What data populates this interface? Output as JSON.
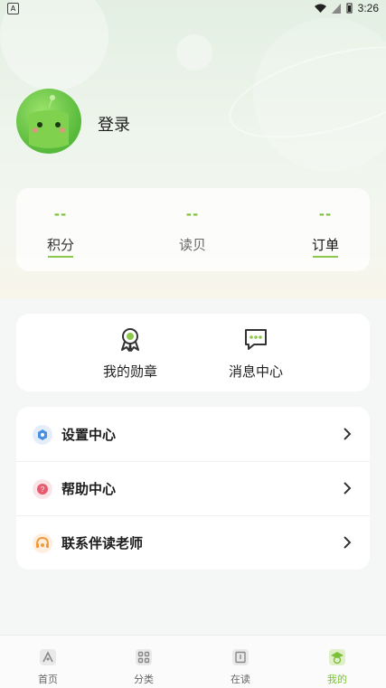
{
  "status_bar": {
    "time": "3:26",
    "app_badge": "A"
  },
  "profile": {
    "login_label": "登录"
  },
  "stats": [
    {
      "value": "--",
      "label": "积分"
    },
    {
      "value": "--",
      "label": "读贝"
    },
    {
      "value": "--",
      "label": "订单"
    }
  ],
  "shortcuts": [
    {
      "label": "我的勋章",
      "icon": "medal-icon"
    },
    {
      "label": "消息中心",
      "icon": "message-icon"
    }
  ],
  "menu": [
    {
      "label": "设置中心",
      "icon": "settings-icon",
      "color": "#4a90e2"
    },
    {
      "label": "帮助中心",
      "icon": "help-icon",
      "color": "#e85a6e"
    },
    {
      "label": "联系伴读老师",
      "icon": "contact-icon",
      "color": "#f29a3b"
    }
  ],
  "tabs": [
    {
      "label": "首页",
      "icon": "home-icon",
      "active": false
    },
    {
      "label": "分类",
      "icon": "category-icon",
      "active": false
    },
    {
      "label": "在读",
      "icon": "book-icon",
      "active": false
    },
    {
      "label": "我的",
      "icon": "profile-icon",
      "active": true
    }
  ],
  "colors": {
    "accent": "#7cbf38"
  }
}
